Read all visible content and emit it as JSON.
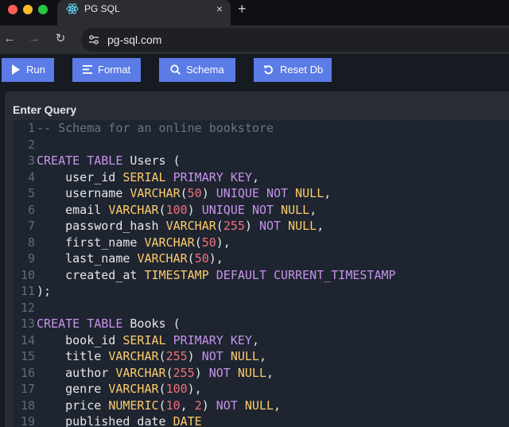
{
  "browser": {
    "tab_title": "PG SQL",
    "tab_close": "×",
    "new_tab": "+",
    "url": "pg-sql.com",
    "back": "←",
    "forward": "→",
    "reload": "↻"
  },
  "toolbar": {
    "run_label": "Run",
    "format_label": "Format",
    "schema_label": "Schema",
    "reset_label": "Reset Db"
  },
  "editor": {
    "title": "Enter Query",
    "lines": [
      [
        [
          "c",
          "-- Schema for an online bookstore"
        ]
      ],
      [],
      [
        [
          "k",
          "CREATE"
        ],
        [
          "p",
          " "
        ],
        [
          "k",
          "TABLE"
        ],
        [
          "p",
          " Users ("
        ]
      ],
      [
        [
          "p",
          "    user_id "
        ],
        [
          "ty",
          "SERIAL"
        ],
        [
          "p",
          " "
        ],
        [
          "k",
          "PRIMARY"
        ],
        [
          "p",
          " "
        ],
        [
          "k",
          "KEY"
        ],
        [
          "p",
          ","
        ]
      ],
      [
        [
          "p",
          "    username "
        ],
        [
          "ty",
          "VARCHAR"
        ],
        [
          "p",
          "("
        ],
        [
          "n",
          "50"
        ],
        [
          "p",
          ") "
        ],
        [
          "k",
          "UNIQUE"
        ],
        [
          "p",
          " "
        ],
        [
          "k",
          "NOT"
        ],
        [
          "p",
          " "
        ],
        [
          "ty",
          "NULL"
        ],
        [
          "p",
          ","
        ]
      ],
      [
        [
          "p",
          "    email "
        ],
        [
          "ty",
          "VARCHAR"
        ],
        [
          "p",
          "("
        ],
        [
          "n",
          "100"
        ],
        [
          "p",
          ") "
        ],
        [
          "k",
          "UNIQUE"
        ],
        [
          "p",
          " "
        ],
        [
          "k",
          "NOT"
        ],
        [
          "p",
          " "
        ],
        [
          "ty",
          "NULL"
        ],
        [
          "p",
          ","
        ]
      ],
      [
        [
          "p",
          "    password_hash "
        ],
        [
          "ty",
          "VARCHAR"
        ],
        [
          "p",
          "("
        ],
        [
          "n",
          "255"
        ],
        [
          "p",
          ") "
        ],
        [
          "k",
          "NOT"
        ],
        [
          "p",
          " "
        ],
        [
          "ty",
          "NULL"
        ],
        [
          "p",
          ","
        ]
      ],
      [
        [
          "p",
          "    first_name "
        ],
        [
          "ty",
          "VARCHAR"
        ],
        [
          "p",
          "("
        ],
        [
          "n",
          "50"
        ],
        [
          "p",
          "),"
        ]
      ],
      [
        [
          "p",
          "    last_name "
        ],
        [
          "ty",
          "VARCHAR"
        ],
        [
          "p",
          "("
        ],
        [
          "n",
          "50"
        ],
        [
          "p",
          "),"
        ]
      ],
      [
        [
          "p",
          "    created_at "
        ],
        [
          "ty",
          "TIMESTAMP"
        ],
        [
          "p",
          " "
        ],
        [
          "k",
          "DEFAULT"
        ],
        [
          "p",
          " "
        ],
        [
          "k",
          "CURRENT_TIMESTAMP"
        ]
      ],
      [
        [
          "p",
          ");"
        ]
      ],
      [],
      [
        [
          "k",
          "CREATE"
        ],
        [
          "p",
          " "
        ],
        [
          "k",
          "TABLE"
        ],
        [
          "p",
          " Books ("
        ]
      ],
      [
        [
          "p",
          "    book_id "
        ],
        [
          "ty",
          "SERIAL"
        ],
        [
          "p",
          " "
        ],
        [
          "k",
          "PRIMARY"
        ],
        [
          "p",
          " "
        ],
        [
          "k",
          "KEY"
        ],
        [
          "p",
          ","
        ]
      ],
      [
        [
          "p",
          "    title "
        ],
        [
          "ty",
          "VARCHAR"
        ],
        [
          "p",
          "("
        ],
        [
          "n",
          "255"
        ],
        [
          "p",
          ") "
        ],
        [
          "k",
          "NOT"
        ],
        [
          "p",
          " "
        ],
        [
          "ty",
          "NULL"
        ],
        [
          "p",
          ","
        ]
      ],
      [
        [
          "p",
          "    author "
        ],
        [
          "ty",
          "VARCHAR"
        ],
        [
          "p",
          "("
        ],
        [
          "n",
          "255"
        ],
        [
          "p",
          ") "
        ],
        [
          "k",
          "NOT"
        ],
        [
          "p",
          " "
        ],
        [
          "ty",
          "NULL"
        ],
        [
          "p",
          ","
        ]
      ],
      [
        [
          "p",
          "    genre "
        ],
        [
          "ty",
          "VARCHAR"
        ],
        [
          "p",
          "("
        ],
        [
          "n",
          "100"
        ],
        [
          "p",
          "),"
        ]
      ],
      [
        [
          "p",
          "    price "
        ],
        [
          "ty",
          "NUMERIC"
        ],
        [
          "p",
          "("
        ],
        [
          "n",
          "10"
        ],
        [
          "p",
          ", "
        ],
        [
          "n",
          "2"
        ],
        [
          "p",
          ") "
        ],
        [
          "k",
          "NOT"
        ],
        [
          "p",
          " "
        ],
        [
          "ty",
          "NULL"
        ],
        [
          "p",
          ","
        ]
      ],
      [
        [
          "p",
          "    published_date "
        ],
        [
          "ty",
          "DATE"
        ]
      ]
    ]
  },
  "colors": {
    "accent": "#5b7ce6",
    "keyword": "#c792ea",
    "type": "#ffcb6b",
    "number": "#f07178",
    "comment": "#697483"
  }
}
